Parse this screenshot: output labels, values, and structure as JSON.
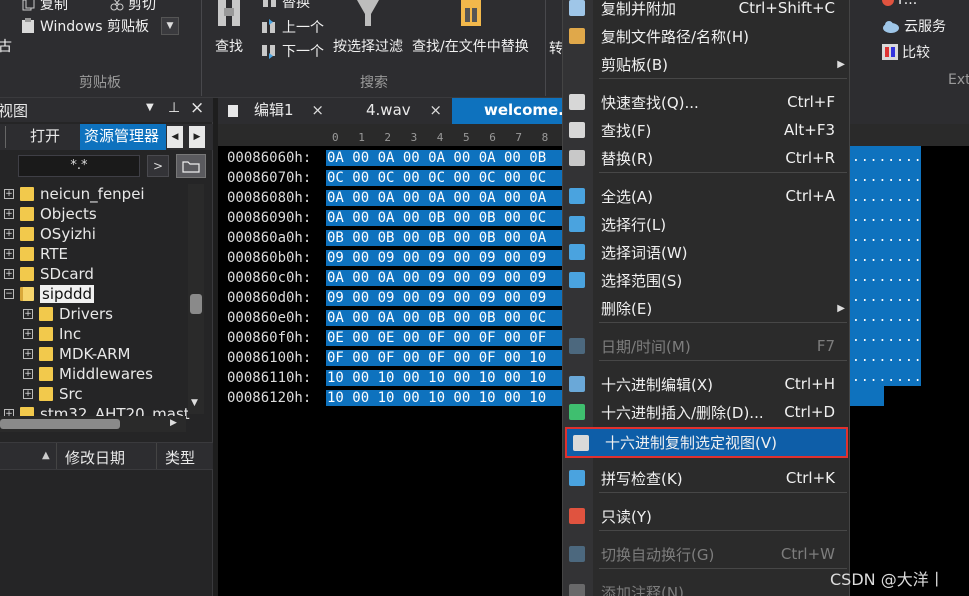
{
  "ribbon": {
    "copy_label": "复制",
    "cut_label": "剪切",
    "clipboard_combo_value": "Windows 剪贴板",
    "clipboard_group_label": "剪贴板",
    "find_label": "查找",
    "replace_label": "替换",
    "find_prev_label": "上一个",
    "find_next_label": "下一个",
    "filter_label": "按选择过滤",
    "find_in_files_label": "查找/在文件中替换",
    "search_group_label": "搜索",
    "truncated_left_label": "古",
    "truncated_right_label": "转",
    "right": {
      "cloud_label": "云服务",
      "compare_label": "比较",
      "group_label": "Ext",
      "top_label": "F..."
    }
  },
  "left_panel": {
    "title": "视图",
    "pin_glyph": "⊥",
    "close_glyph": "×",
    "tabs": [
      "打开",
      "资源管理器"
    ],
    "filter_value": "*.*",
    "tree": [
      {
        "label": "neicun_fenpei",
        "level": 0
      },
      {
        "label": "Objects",
        "level": 0
      },
      {
        "label": "OSyizhi",
        "level": 0
      },
      {
        "label": "RTE",
        "level": 0
      },
      {
        "label": "SDcard",
        "level": 0
      },
      {
        "label": "sipddd",
        "level": 0,
        "expanded": true,
        "selected": true
      },
      {
        "label": "Drivers",
        "level": 1
      },
      {
        "label": "Inc",
        "level": 1
      },
      {
        "label": "MDK-ARM",
        "level": 1
      },
      {
        "label": "Middlewares",
        "level": 1
      },
      {
        "label": "Src",
        "level": 1
      },
      {
        "label": "stm32_AHT20_master",
        "level": 0
      }
    ],
    "columns": {
      "name_sort": "▲",
      "modified": "修改日期",
      "type": "类型"
    }
  },
  "editor": {
    "tabs": [
      {
        "label": "编辑1",
        "active": false
      },
      {
        "label": "4.wav",
        "active": false
      },
      {
        "label": "welcome.v",
        "active": true
      }
    ],
    "ruler": [
      "0",
      "1",
      "2",
      "3",
      "4",
      "5",
      "6",
      "7",
      "8"
    ],
    "rows": [
      {
        "addr": "00086060h:",
        "bytes": "0A 00 0A 00 0A 00 0A 00 0B"
      },
      {
        "addr": "00086070h:",
        "bytes": "0C 00 0C 00 0C 00 0C 00 0C"
      },
      {
        "addr": "00086080h:",
        "bytes": "0A 00 0A 00 0A 00 0A 00 0A"
      },
      {
        "addr": "00086090h:",
        "bytes": "0A 00 0A 00 0B 00 0B 00 0C"
      },
      {
        "addr": "000860a0h:",
        "bytes": "0B 00 0B 00 0B 00 0B 00 0A"
      },
      {
        "addr": "000860b0h:",
        "bytes": "09 00 09 00 09 00 09 00 09"
      },
      {
        "addr": "000860c0h:",
        "bytes": "0A 00 0A 00 09 00 09 00 09"
      },
      {
        "addr": "000860d0h:",
        "bytes": "09 00 09 00 09 00 09 00 09"
      },
      {
        "addr": "000860e0h:",
        "bytes": "0A 00 0A 00 0B 00 0B 00 0C"
      },
      {
        "addr": "000860f0h:",
        "bytes": "0E 00 0E 00 0F 00 0F 00 0F"
      },
      {
        "addr": "00086100h:",
        "bytes": "0F 00 0F 00 0F 00 0F 00 10"
      },
      {
        "addr": "00086110h:",
        "bytes": "10 00 10 00 10 00 10 00 10"
      },
      {
        "addr": "00086120h:",
        "bytes": "10 00 10 00 10 00 10 00 10"
      }
    ],
    "ascii_dots": "........"
  },
  "context_menu": {
    "items": [
      {
        "label": "复制并附加",
        "shortcut": "Ctrl+Shift+C",
        "icon": "copy-append-icon"
      },
      {
        "label": "复制文件路径/名称(H)",
        "shortcut": "",
        "icon": "copy-path-icon"
      },
      {
        "label": "剪贴板(B)",
        "shortcut": "",
        "submenu": true
      },
      {
        "label": "快速查找(Q)...",
        "shortcut": "Ctrl+F",
        "icon": "quick-find-icon"
      },
      {
        "label": "查找(F)",
        "shortcut": "Alt+F3",
        "icon": "find-icon"
      },
      {
        "label": "替换(R)",
        "shortcut": "Ctrl+R",
        "icon": "replace-icon"
      },
      {
        "label": "全选(A)",
        "shortcut": "Ctrl+A",
        "icon": "select-all-icon"
      },
      {
        "label": "选择行(L)",
        "shortcut": "",
        "icon": "select-line-icon"
      },
      {
        "label": "选择词语(W)",
        "shortcut": "",
        "icon": "select-word-icon"
      },
      {
        "label": "选择范围(S)",
        "shortcut": "",
        "icon": "select-range-icon"
      },
      {
        "label": "删除(E)",
        "shortcut": "",
        "submenu": true
      },
      {
        "label": "日期/时间(M)",
        "shortcut": "F7",
        "disabled": true,
        "icon": "datetime-icon"
      },
      {
        "label": "十六进制编辑(X)",
        "shortcut": "Ctrl+H",
        "icon": "hex-edit-icon"
      },
      {
        "label": "十六进制插入/删除(D)...",
        "shortcut": "Ctrl+D",
        "icon": "hex-insert-icon"
      },
      {
        "label": "十六进制复制选定视图(V)",
        "shortcut": "",
        "highlight": true,
        "icon": "hex-copy-view-icon"
      },
      {
        "label": "拼写检查(K)",
        "shortcut": "Ctrl+K",
        "icon": "spellcheck-icon"
      },
      {
        "label": "只读(Y)",
        "shortcut": "",
        "icon": "read-only-icon"
      },
      {
        "label": "切换自动换行(G)",
        "shortcut": "Ctrl+W",
        "disabled": true,
        "icon": "word-wrap-icon"
      },
      {
        "label": "添加注释(N)",
        "shortcut": "",
        "disabled": true,
        "icon": "comment-icon"
      }
    ]
  },
  "watermark": "CSDN @大洋丨",
  "colors": {
    "accent": "#0e72be",
    "highlight_border": "#e0302e",
    "background": "#1e1e1e",
    "menu_bg": "#2b2b2b",
    "folder": "#f2c94c"
  }
}
